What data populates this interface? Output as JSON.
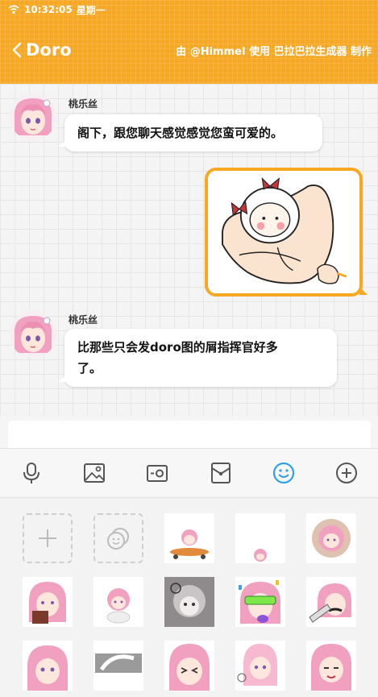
{
  "status": {
    "time": "10:32:05",
    "weekday": "星期一"
  },
  "header": {
    "title": "Doro",
    "credit": "由 @Himmel 使用 巴拉巴拉生成器 制作"
  },
  "messages": [
    {
      "sender": "桃乐丝",
      "text": "阁下，跟您聊天感觉感觉您蛮可爱的。"
    },
    {
      "sender": "桃乐丝",
      "text_line1": "比那些只会发doro图的屑指挥官好多",
      "text_line2": "了。"
    }
  ],
  "colors": {
    "accent": "#f7a823",
    "icon": "#555555",
    "emoji_active": "#2ea0e8"
  },
  "toolbar_icons": [
    "microphone-icon",
    "image-icon",
    "camera-icon",
    "red-packet-icon",
    "emoji-icon",
    "plus-icon"
  ],
  "sticker_panel": {
    "controls": [
      "add-sticker-icon",
      "sticker-history-icon"
    ]
  }
}
